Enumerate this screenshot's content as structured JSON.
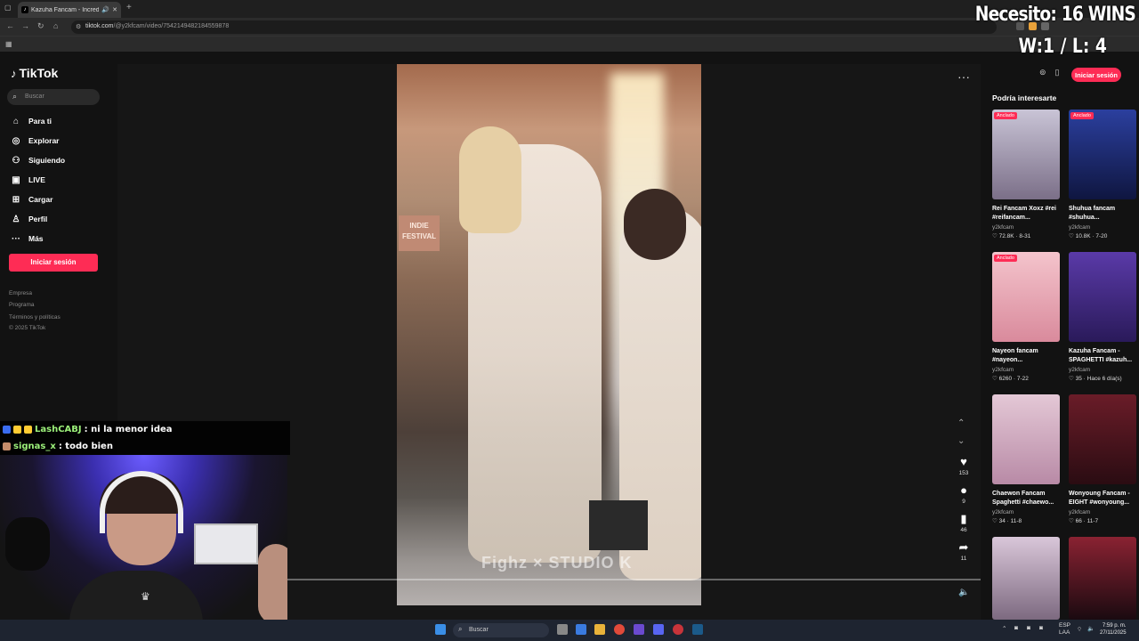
{
  "browser": {
    "tab_title": "Kazuha Fancam - Incredib",
    "tab_favicon": "tiktok-icon",
    "url_host": "tiktok.com",
    "url_path": "/@y2kfcam/video/7542149482184559878"
  },
  "overlay": {
    "goal": "Necesito: 16 WINS",
    "record": "W:1 / L: 4"
  },
  "tiktok": {
    "logo": "TikTok",
    "search_placeholder": "Buscar",
    "nav": [
      {
        "label": "Para ti",
        "icon": "home-icon"
      },
      {
        "label": "Explorar",
        "icon": "compass-icon"
      },
      {
        "label": "Siguiendo",
        "icon": "following-icon"
      },
      {
        "label": "LIVE",
        "icon": "live-icon"
      },
      {
        "label": "Cargar",
        "icon": "upload-icon"
      },
      {
        "label": "Perfil",
        "icon": "profile-icon"
      },
      {
        "label": "Más",
        "icon": "more-icon"
      }
    ],
    "login_label": "Iniciar sesión",
    "footer": [
      "Empresa",
      "Programa",
      "Términos y políticas",
      "© 2025 TikTok"
    ],
    "video": {
      "sign_text": "INDIE FESTIVAL",
      "watermark": "Fighz × STUDIO K"
    },
    "actions": {
      "likes": "153",
      "comments": "9",
      "saves": "46",
      "shares": "11"
    },
    "suggest_title": "Podría interesarte",
    "cards": [
      {
        "pinned": "Anclado",
        "title": "Rei Fancam Xoxz #rei #reifancam...",
        "user": "y2kfcam",
        "meta": "♡ 72.8K · 8-31",
        "colors": [
          "#c9c4d6",
          "#7b6f88"
        ]
      },
      {
        "pinned": "Anclado",
        "title": "Shuhua fancam #shuhua...",
        "user": "y2kfcam",
        "meta": "♡ 10.8K · 7-20",
        "colors": [
          "#2b3f9e",
          "#0f1640"
        ]
      },
      {
        "pinned": "Anclado",
        "title": "Nayeon fancam #nayeon...",
        "user": "y2kfcam",
        "meta": "♡ 6260 · 7-22",
        "colors": [
          "#f4c4cc",
          "#d98a9c"
        ]
      },
      {
        "pinned": "",
        "title": "Kazuha Fancam - SPAGHETTI #kazuh...",
        "user": "y2kfcam",
        "meta": "♡ 35 · Hace 6 día(s)",
        "colors": [
          "#5a3aa8",
          "#2a1a5a"
        ]
      },
      {
        "pinned": "",
        "title": "Chaewon Fancam Spaghetti #chaewo...",
        "user": "y2kfcam",
        "meta": "♡ 34 · 11-8",
        "colors": [
          "#e4c8d6",
          "#b88aa6"
        ]
      },
      {
        "pinned": "",
        "title": "Wonyoung Fancam - EIGHT #wonyoung...",
        "user": "y2kfcam",
        "meta": "♡ 66 · 11-7",
        "colors": [
          "#6a1c28",
          "#2a0c12"
        ]
      },
      {
        "pinned": "",
        "title": "",
        "user": "",
        "meta": "",
        "colors": [
          "#d9c7d9",
          "#7d6a80"
        ]
      },
      {
        "pinned": "",
        "title": "",
        "user": "",
        "meta": "",
        "colors": [
          "#8a2232",
          "#1a0a10"
        ]
      }
    ]
  },
  "chat": [
    {
      "user": "LashCABJ",
      "message": ": ni la menor idea",
      "badges": [
        "#3a6cf0",
        "#ffcc33",
        "#ffcc33"
      ]
    },
    {
      "user": "signas_x",
      "message": ": todo bien",
      "badges": [
        "#c58c6a"
      ]
    }
  ],
  "taskbar": {
    "search_placeholder": "Buscar",
    "lang": "ESP",
    "lang2": "LAA",
    "time": "7:59 p. m.",
    "date": "27/11/2025"
  }
}
